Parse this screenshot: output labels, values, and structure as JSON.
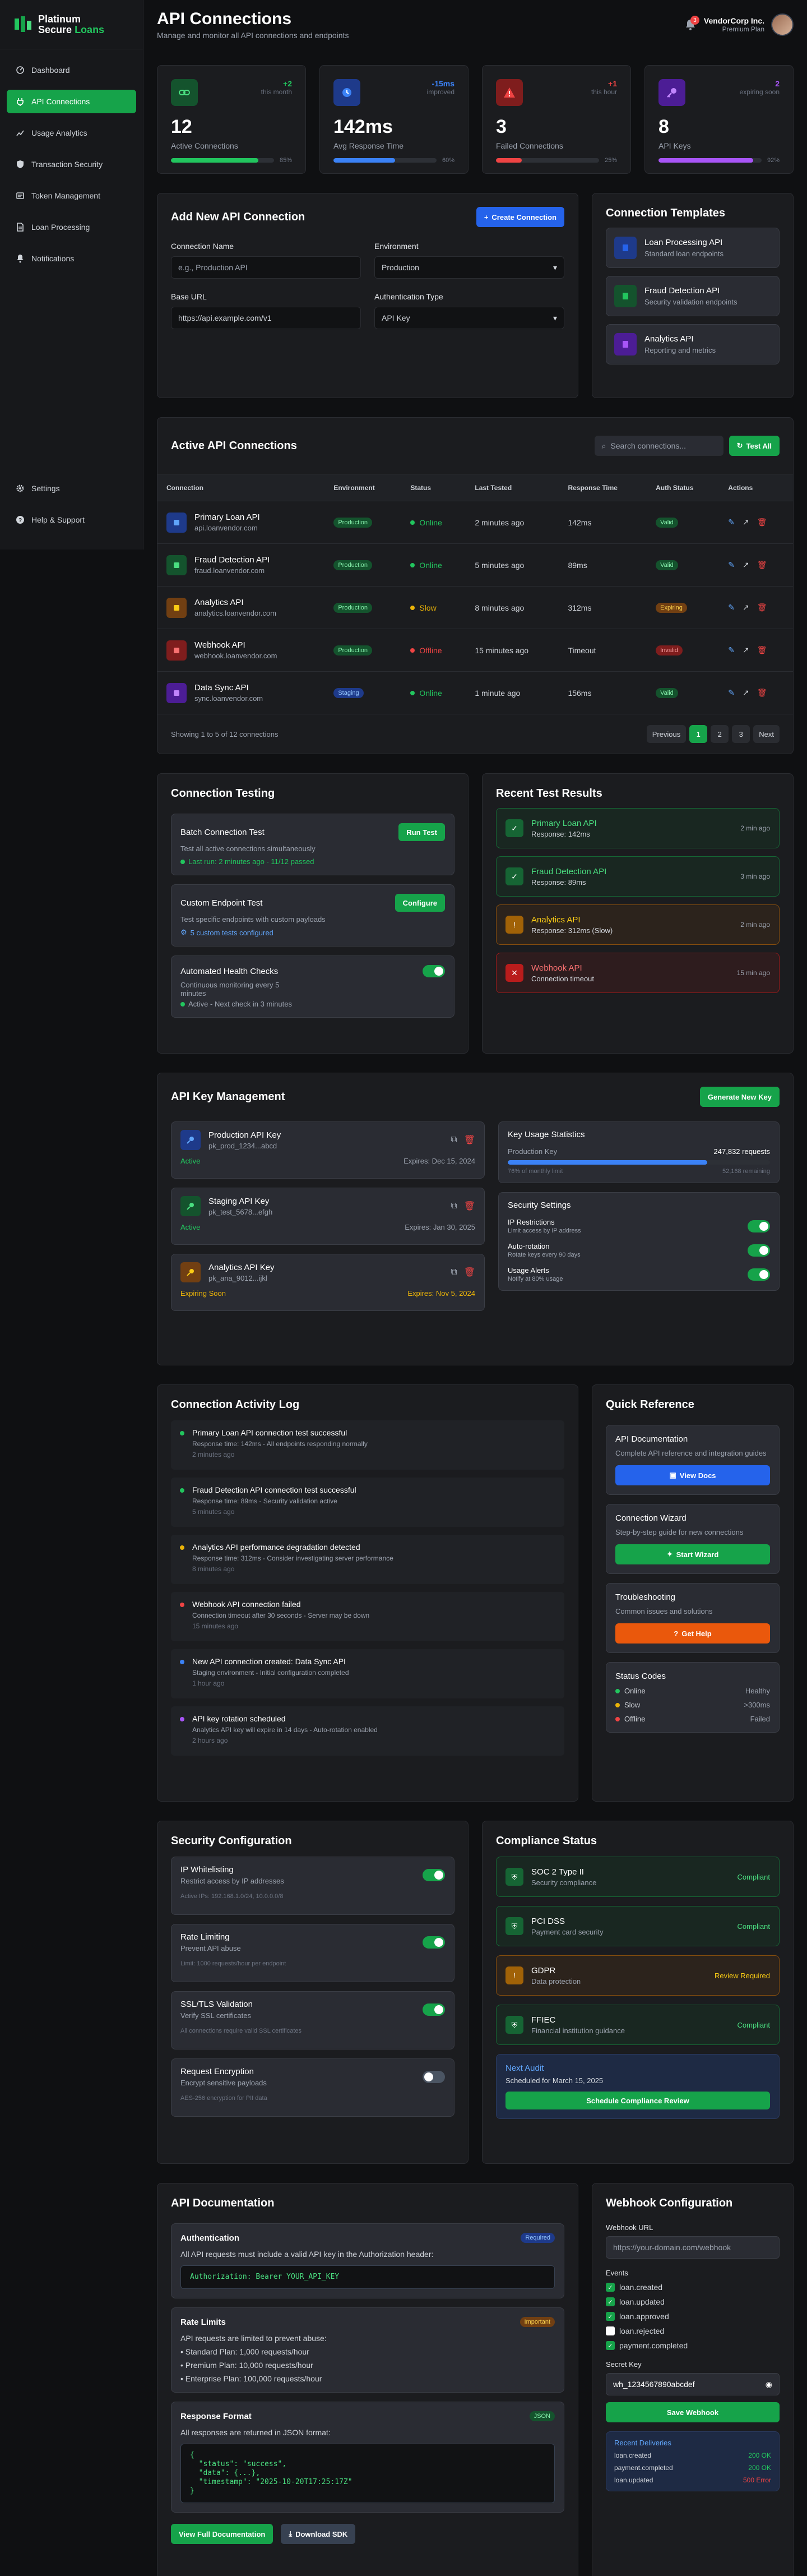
{
  "brand": {
    "line1": "Platinum",
    "line2a": "Secure",
    "line2b": "Loans"
  },
  "sidebar": {
    "items": [
      {
        "label": "Dashboard",
        "icon": "dashboard-icon"
      },
      {
        "label": "API Connections",
        "icon": "plug-icon",
        "active": true
      },
      {
        "label": "Usage Analytics",
        "icon": "chart-icon"
      },
      {
        "label": "Transaction Security",
        "icon": "shield-icon"
      },
      {
        "label": "Token Management",
        "icon": "token-icon"
      },
      {
        "label": "Loan Processing",
        "icon": "document-icon"
      },
      {
        "label": "Notifications",
        "icon": "bell-icon"
      }
    ],
    "bottom": [
      {
        "label": "Settings",
        "icon": "gear-icon"
      },
      {
        "label": "Help & Support",
        "icon": "help-icon"
      }
    ]
  },
  "header": {
    "title": "API Connections",
    "subtitle": "Manage and monitor all API connections and endpoints",
    "notif_count": "3",
    "company": "VendorCorp Inc.",
    "plan": "Premium Plan"
  },
  "stats": [
    {
      "delta": "+2",
      "delta_label": "this month",
      "value": "12",
      "label": "Active Connections",
      "pct": 85,
      "pct_label": "85%",
      "color": "#22c55e",
      "icon": "link-icon"
    },
    {
      "delta": "-15ms",
      "delta_label": "improved",
      "value": "142ms",
      "label": "Avg Response Time",
      "pct": 60,
      "pct_label": "60%",
      "color": "#3b82f6",
      "icon": "clock-icon"
    },
    {
      "delta": "+1",
      "delta_label": "this hour",
      "value": "3",
      "label": "Failed Connections",
      "pct": 25,
      "pct_label": "25%",
      "color": "#ef4444",
      "icon": "warning-icon"
    },
    {
      "delta": "2",
      "delta_label": "expiring soon",
      "value": "8",
      "label": "API Keys",
      "pct": 92,
      "pct_label": "92%",
      "color": "#a855f7",
      "icon": "key-icon"
    }
  ],
  "add_form": {
    "title": "Add New API Connection",
    "create_label": "Create Connection",
    "name_label": "Connection Name",
    "name_placeholder": "e.g., Production API",
    "env_label": "Environment",
    "env_value": "Production",
    "url_label": "Base URL",
    "url_placeholder": "https://api.example.com/v1",
    "auth_label": "Authentication Type",
    "auth_value": "API Key"
  },
  "templates": {
    "title": "Connection Templates",
    "items": [
      {
        "name": "Loan Processing API",
        "desc": "Standard loan endpoints",
        "color": "#2563eb",
        "bg": "#1e3a8a"
      },
      {
        "name": "Fraud Detection API",
        "desc": "Security validation endpoints",
        "color": "#22c55e",
        "bg": "#14532d"
      },
      {
        "name": "Analytics API",
        "desc": "Reporting and metrics",
        "color": "#a855f7",
        "bg": "#4c1d95"
      }
    ]
  },
  "active": {
    "title": "Active API Connections",
    "search_placeholder": "Search connections...",
    "test_all": "Test All",
    "columns": [
      "Connection",
      "Environment",
      "Status",
      "Last Tested",
      "Response Time",
      "Auth Status",
      "Actions"
    ],
    "rows": [
      {
        "name": "Primary Loan API",
        "url": "api.loanvendor.com",
        "env": "Production",
        "env_style": "green",
        "status": "Online",
        "status_color": "#22c55e",
        "tested": "2 minutes ago",
        "resp": "142ms",
        "auth": "Valid",
        "auth_style": "green",
        "ic_color": "#60a5fa",
        "ic_bg": "#1e3a8a"
      },
      {
        "name": "Fraud Detection API",
        "url": "fraud.loanvendor.com",
        "env": "Production",
        "env_style": "green",
        "status": "Online",
        "status_color": "#22c55e",
        "tested": "5 minutes ago",
        "resp": "89ms",
        "auth": "Valid",
        "auth_style": "green",
        "ic_color": "#4ade80",
        "ic_bg": "#14532d"
      },
      {
        "name": "Analytics API",
        "url": "analytics.loanvendor.com",
        "env": "Production",
        "env_style": "green",
        "status": "Slow",
        "status_color": "#eab308",
        "tested": "8 minutes ago",
        "resp": "312ms",
        "auth": "Expiring",
        "auth_style": "yellow",
        "ic_color": "#facc15",
        "ic_bg": "#713f12"
      },
      {
        "name": "Webhook API",
        "url": "webhook.loanvendor.com",
        "env": "Production",
        "env_style": "green",
        "status": "Offline",
        "status_color": "#ef4444",
        "tested": "15 minutes ago",
        "resp": "Timeout",
        "auth": "Invalid",
        "auth_style": "red",
        "ic_color": "#f87171",
        "ic_bg": "#7f1d1d"
      },
      {
        "name": "Data Sync API",
        "url": "sync.loanvendor.com",
        "env": "Staging",
        "env_style": "blue",
        "status": "Online",
        "status_color": "#22c55e",
        "tested": "1 minute ago",
        "resp": "156ms",
        "auth": "Valid",
        "auth_style": "green",
        "ic_color": "#c084fc",
        "ic_bg": "#4c1d95"
      }
    ],
    "showing": "Showing 1 to 5 of 12 connections",
    "prev": "Previous",
    "pages": [
      "1",
      "2",
      "3"
    ],
    "next": "Next"
  },
  "testing": {
    "title": "Connection Testing",
    "batch": {
      "title": "Batch Connection Test",
      "btn": "Run Test",
      "desc": "Test all active connections simultaneously",
      "status": "Last run: 2 minutes ago - 11/12 passed"
    },
    "custom": {
      "title": "Custom Endpoint Test",
      "btn": "Configure",
      "desc": "Test specific endpoints with custom payloads",
      "status": "5 custom tests configured"
    },
    "auto": {
      "title": "Automated Health Checks",
      "desc": "Continuous monitoring every 5 minutes",
      "status": "Active - Next check in 3 minutes"
    }
  },
  "results": {
    "title": "Recent Test Results",
    "items": [
      {
        "name": "Primary Loan API",
        "desc": "Response: 142ms",
        "time": "2 min ago",
        "kind": "ok"
      },
      {
        "name": "Fraud Detection API",
        "desc": "Response: 89ms",
        "time": "3 min ago",
        "kind": "ok"
      },
      {
        "name": "Analytics API",
        "desc": "Response: 312ms (Slow)",
        "time": "2 min ago",
        "kind": "warn"
      },
      {
        "name": "Webhook API",
        "desc": "Connection timeout",
        "time": "15 min ago",
        "kind": "err"
      }
    ]
  },
  "keys": {
    "title": "API Key Management",
    "gen": "Generate New Key",
    "items": [
      {
        "name": "Production API Key",
        "value": "pk_prod_1234...abcd",
        "status": "Active",
        "expires": "Expires: Dec 15, 2024",
        "color": "#22c55e",
        "ic_bg": "#1e3a8a",
        "ic_color": "#60a5fa"
      },
      {
        "name": "Staging API Key",
        "value": "pk_test_5678...efgh",
        "status": "Active",
        "expires": "Expires: Jan 30, 2025",
        "color": "#22c55e",
        "ic_bg": "#14532d",
        "ic_color": "#4ade80"
      },
      {
        "name": "Analytics API Key",
        "value": "pk_ana_9012...ijkl",
        "status": "Expiring Soon",
        "expires": "Expires: Nov 5, 2024",
        "color": "#eab308",
        "ic_bg": "#713f12",
        "ic_color": "#facc15"
      }
    ],
    "usage": {
      "title": "Key Usage Statistics",
      "key": "Production Key",
      "requests": "247,832 requests",
      "pct": 76,
      "left": "76% of monthly limit",
      "right": "52,168 remaining"
    },
    "security": {
      "title": "Security Settings",
      "items": [
        {
          "name": "IP Restrictions",
          "desc": "Limit access by IP address"
        },
        {
          "name": "Auto-rotation",
          "desc": "Rotate keys every 90 days"
        },
        {
          "name": "Usage Alerts",
          "desc": "Notify at 80% usage"
        }
      ]
    }
  },
  "log": {
    "title": "Connection Activity Log",
    "items": [
      {
        "title": "Primary Loan API connection test successful",
        "desc": "Response time: 142ms - All endpoints responding normally",
        "time": "2 minutes ago",
        "color": "#22c55e"
      },
      {
        "title": "Fraud Detection API connection test successful",
        "desc": "Response time: 89ms - Security validation active",
        "time": "5 minutes ago",
        "color": "#22c55e"
      },
      {
        "title": "Analytics API performance degradation detected",
        "desc": "Response time: 312ms - Consider investigating server performance",
        "time": "8 minutes ago",
        "color": "#eab308"
      },
      {
        "title": "Webhook API connection failed",
        "desc": "Connection timeout after 30 seconds - Server may be down",
        "time": "15 minutes ago",
        "color": "#ef4444"
      },
      {
        "title": "New API connection created: Data Sync API",
        "desc": "Staging environment - Initial configuration completed",
        "time": "1 hour ago",
        "color": "#3b82f6"
      },
      {
        "title": "API key rotation scheduled",
        "desc": "Analytics API key will expire in 14 days - Auto-rotation enabled",
        "time": "2 hours ago",
        "color": "#a855f7"
      }
    ]
  },
  "quickref": {
    "title": "Quick Reference",
    "docs": {
      "title": "API Documentation",
      "desc": "Complete API reference and integration guides",
      "btn": "View Docs"
    },
    "wizard": {
      "title": "Connection Wizard",
      "desc": "Step-by-step guide for new connections",
      "btn": "Start Wizard"
    },
    "trouble": {
      "title": "Troubleshooting",
      "desc": "Common issues and solutions",
      "btn": "Get Help"
    },
    "codes": {
      "title": "Status Codes",
      "items": [
        {
          "label": "Online",
          "value": "Healthy",
          "color": "#22c55e"
        },
        {
          "label": "Slow",
          "value": ">300ms",
          "color": "#eab308"
        },
        {
          "label": "Offline",
          "value": "Failed",
          "color": "#ef4444"
        }
      ]
    }
  },
  "secconf": {
    "title": "Security Configuration",
    "items": [
      {
        "name": "IP Whitelisting",
        "desc": "Restrict access by IP addresses",
        "sub": "Active IPs: 192.168.1.0/24, 10.0.0.0/8",
        "on": true
      },
      {
        "name": "Rate Limiting",
        "desc": "Prevent API abuse",
        "sub": "Limit: 1000 requests/hour per endpoint",
        "on": true
      },
      {
        "name": "SSL/TLS Validation",
        "desc": "Verify SSL certificates",
        "sub": "All connections require valid SSL certificates",
        "on": true
      },
      {
        "name": "Request Encryption",
        "desc": "Encrypt sensitive payloads",
        "sub": "AES-256 encryption for PII data",
        "on": false
      }
    ]
  },
  "compliance": {
    "title": "Compliance Status",
    "items": [
      {
        "name": "SOC 2 Type II",
        "desc": "Security compliance",
        "status": "Compliant",
        "kind": "ok"
      },
      {
        "name": "PCI DSS",
        "desc": "Payment card security",
        "status": "Compliant",
        "kind": "ok"
      },
      {
        "name": "GDPR",
        "desc": "Data protection",
        "status": "Review Required",
        "kind": "warn"
      },
      {
        "name": "FFIEC",
        "desc": "Financial institution guidance",
        "status": "Compliant",
        "kind": "ok"
      }
    ],
    "audit": {
      "title": "Next Audit",
      "date": "Scheduled for March 15, 2025",
      "btn": "Schedule Compliance Review"
    }
  },
  "docs": {
    "title": "API Documentation",
    "auth": {
      "title": "Authentication",
      "badge": "Required",
      "desc": "All API requests must include a valid API key in the Authorization header:",
      "code": "Authorization: Bearer YOUR_API_KEY"
    },
    "rate": {
      "title": "Rate Limits",
      "badge": "Important",
      "desc": "API requests are limited to prevent abuse:",
      "items": [
        "• Standard Plan: 1,000 requests/hour",
        "• Premium Plan: 10,000 requests/hour",
        "• Enterprise Plan: 100,000 requests/hour"
      ]
    },
    "resp": {
      "title": "Response Format",
      "badge": "JSON",
      "desc": "All responses are returned in JSON format:",
      "code": [
        "{",
        "  \"status\": \"success\",",
        "  \"data\": {...},",
        "  \"timestamp\": \"2025-10-20T17:25:17Z\"",
        "}"
      ]
    },
    "btn_full": "View Full Documentation",
    "btn_sdk": "Download SDK"
  },
  "webhook": {
    "title": "Webhook Configuration",
    "url_label": "Webhook URL",
    "url_placeholder": "https://your-domain.com/webhook",
    "events_label": "Events",
    "events": [
      {
        "label": "loan.created",
        "on": true
      },
      {
        "label": "loan.updated",
        "on": true
      },
      {
        "label": "loan.approved",
        "on": true
      },
      {
        "label": "loan.rejected",
        "on": false
      },
      {
        "label": "payment.completed",
        "on": true
      }
    ],
    "secret_label": "Secret Key",
    "secret_value": "wh_1234567890abcdef",
    "save": "Save Webhook",
    "deliveries": {
      "title": "Recent Deliveries",
      "items": [
        {
          "event": "loan.created",
          "status": "200 OK",
          "color": "#22c55e"
        },
        {
          "event": "payment.completed",
          "status": "200 OK",
          "color": "#22c55e"
        },
        {
          "event": "loan.updated",
          "status": "500 Error",
          "color": "#ef4444"
        }
      ]
    }
  }
}
